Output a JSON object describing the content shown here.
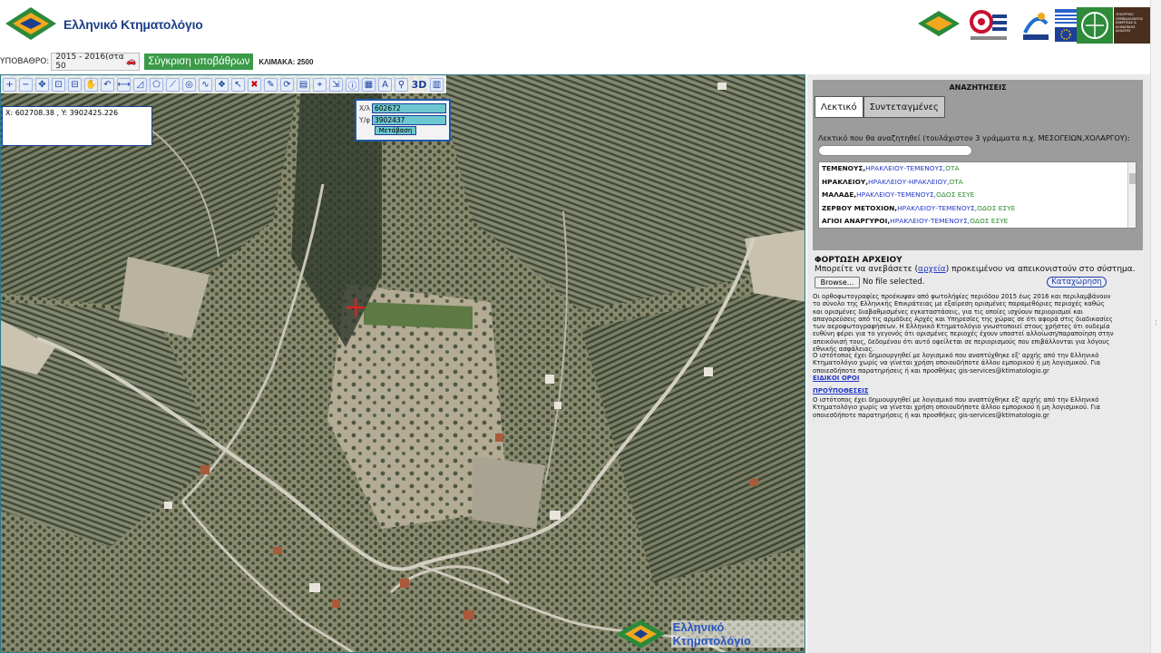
{
  "header": {
    "logo_text": "Ελληνικό Κτηματολόγιο",
    "basemap_label": "ΥΠΟΒΑΘΡΟ:",
    "basemap_value": "2015 - 2016(στα 50",
    "compare_label": "Σύγκριση υποβάθρων",
    "scale_label": "ΚΛΙΜΑΚΑ: 2500",
    "partner_ministry_text": "ΥΠΟΥΡΓΕΙΟ ΠΕΡΙΒΑΛΛΟΝΤΟΣ ΕΝΕΡΓΕΙΑΣ & ΚΛΙΜΑΤΙΚΗΣ ΑΛΛΑΓΗΣ"
  },
  "map": {
    "coords_readout": "X: 602708.38 , Y: 3902425.226",
    "goto": {
      "x_label": "Χ/λ",
      "y_label": "Υ/φ",
      "x_value": "602672",
      "y_value": "3902437",
      "button_label": "Μετάβαση"
    },
    "toolbar_3d_label": "3D",
    "watermark_text": "Ελληνικό Κτηματολόγιο"
  },
  "panel": {
    "search_title": "ΑΝΑΖΗΤΗΣΕΙΣ",
    "tabs": [
      {
        "label": "Λεκτικό"
      },
      {
        "label": "Συντεταγμένες"
      }
    ],
    "search_hint": "Λεκτικό που θα αναζητηθεί (τουλάχιστον 3 γράμματα π.χ. ΜΕΣΟΓΕΙΩΝ,ΧΟΛΑΡΓΟΥ):",
    "search_value": "",
    "results": [
      {
        "place": "ΤΕΜΕΝΟΥΣ,",
        "region": "ΗΡΑΚΛΕΙΟΥ-ΤΕΜΕΝΟΥΣ,",
        "type": "ΟΤΑ"
      },
      {
        "place": "ΗΡΑΚΛΕΙΟΥ,",
        "region": "ΗΡΑΚΛΕΙΟΥ-ΗΡΑΚΛΕΙΟΥ,",
        "type": "ΟΤΑ"
      },
      {
        "place": "ΜΑΛΑΔΕ,",
        "region": "ΗΡΑΚΛΕΙΟΥ-ΤΕΜΕΝΟΥΣ,",
        "type": "ΟΔΟΣ ΕΣΥΕ"
      },
      {
        "place": "ΖΕΡΒΟΥ ΜΕΤΟΧΙΟΝ,",
        "region": "ΗΡΑΚΛΕΙΟΥ-ΤΕΜΕΝΟΥΣ,",
        "type": "ΟΔΟΣ ΕΣΥΕ"
      },
      {
        "place": "ΑΓΙΟΙ ΑΝΑΡΓΥΡΟΙ,",
        "region": "ΗΡΑΚΛΕΙΟΥ-ΤΕΜΕΝΟΥΣ,",
        "type": "ΟΔΟΣ ΕΣΥΕ"
      }
    ],
    "upload": {
      "title": "ΦΟΡΤΩΣΗ ΑΡΧΕΙΟΥ",
      "desc_before": "Μπορείτε να ανεβάσετε (",
      "desc_link": "αρχεία",
      "desc_after": ") προκειμένου να απεικονιστούν στο σύστημα.",
      "browse_label": "Browse...",
      "file_status": "No file selected.",
      "register_label": "Καταχώρηση"
    },
    "disclaimer_1": "Οι ορθοφωτογραφίες προέκυψαν από φωτολήψίες περιόδου 2015 έως 2016 και περιλαμβάνουν το σύνολο της Ελληνικής Επικράτειας με εξαίρεση ορισμένες παραμεθόριες περιοχές καθώς και ορισμένες διαβαθμισμένες εγκαταστάσεις, για τις οποίες ισχύουν περιορισμοί και απαγορεύσεις από τις αρμόδιες Αρχές και Υπηρεσίες της χώρας σε ότι αφορά στις διαδικασίες των αεροφωτογραφήσεων. Η Ελληνικό Κτηματολόγιο γνωστοποιεί στους χρήστες ότι ουδεμία ευθύνη φέρει για το γεγονός ότι ορισμένες περιοχές έχουν υποστεί αλλοίωση/παραποίηση στην απεικόνισή τους, δεδομένου ότι αυτό οφείλεται σε περιορισμούς που επιβάλλονται για λόγους εθνικής ασφάλειας.",
    "disclaimer_2": "Ο ιστότοπος έχει δημιουργηθεί με λογισμικό που αναπτύχθηκε εξ' αρχής από την Ελληνικό Κτηματολόγιο χωρίς να γίνεται χρήση οποιουδήποτε άλλου εμπορικού ή μη λογισμικού. Για οποιεσδήποτε παρατηρήσεις ή και προσθήκες gis-services@ktimatologio.gr",
    "link_terms": "ΕΙΔΙΚΟΙ ΟΡΟΙ",
    "link_prereq": "ΠΡΟΫΠΟΘΕΣΕΙΣ",
    "disclaimer_3": "Ο ιστότοπος έχει δημιουργηθεί με λογισμικό που αναπτύχθηκε εξ' αρχής από την Ελληνικό Κτηματολόγιο χωρίς να γίνεται χρήση οποιουδήποτε άλλου εμπορικού ή μη λογισμικού. Για οποιεσδήποτε παρατηρήσεις ή και προσθήκες gis-services@ktimatologio.gr"
  },
  "colors": {
    "brand_blue": "#1d3f8a",
    "compare_green": "#3a9a48",
    "field_cyan": "#6ec8cf",
    "crosshair_red": "#e02020"
  }
}
